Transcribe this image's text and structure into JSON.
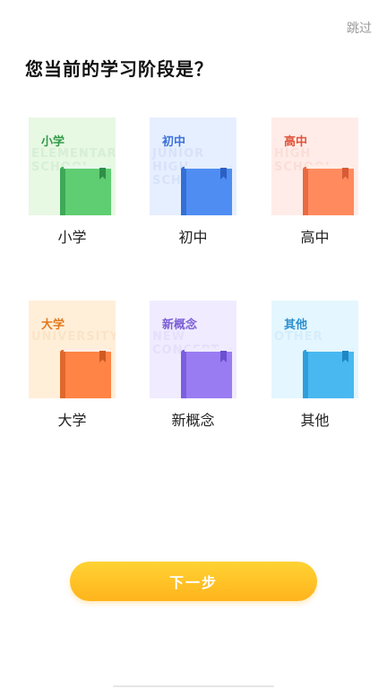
{
  "header": {
    "skip_label": "跳过"
  },
  "question": {
    "title": "您当前的学习阶段是？"
  },
  "options": [
    {
      "card_title": "小学",
      "watermark": "ELEMENTARY\nSCHOOL",
      "label": "小学",
      "colors": {
        "bg": "#e7f8e3",
        "title": "#2f9b46",
        "watermark": "#b9dfbf",
        "book": "#5fcd72",
        "spine": "#3ea957",
        "ribbon": "#2f8f49"
      }
    },
    {
      "card_title": "初中",
      "watermark": "JUNIOR\nHIGH\nSCHOOL",
      "label": "初中",
      "colors": {
        "bg": "#e6efff",
        "title": "#3d71d9",
        "watermark": "#bcccee",
        "book": "#4f8df2",
        "spine": "#356fd4",
        "ribbon": "#2b5fc2"
      }
    },
    {
      "card_title": "高中",
      "watermark": "HIGH\nSCHOOL",
      "label": "高中",
      "colors": {
        "bg": "#ffece8",
        "title": "#e0523a",
        "watermark": "#f3c7bd",
        "book": "#ff8a5e",
        "spine": "#e96a42",
        "ribbon": "#d85a36"
      }
    },
    {
      "card_title": "大学",
      "watermark": "UNIVERSITY",
      "label": "大学",
      "colors": {
        "bg": "#ffefd9",
        "title": "#e27a1f",
        "watermark": "#f2d1a8",
        "book": "#ff8446",
        "spine": "#e0682d",
        "ribbon": "#cf5a22"
      }
    },
    {
      "card_title": "新概念",
      "watermark": "NEW\nCONCEPT",
      "label": "新概念",
      "colors": {
        "bg": "#f0ebff",
        "title": "#7b5fd6",
        "watermark": "#d3c9f2",
        "book": "#9a7cf2",
        "spine": "#7c5fe0",
        "ribbon": "#6a4fd0"
      }
    },
    {
      "card_title": "其他",
      "watermark": "OTHER",
      "label": "其他",
      "colors": {
        "bg": "#e4f6ff",
        "title": "#2b8fcf",
        "watermark": "#b8def2",
        "book": "#4ab8f0",
        "spine": "#2f9fdc",
        "ribbon": "#1f86c4"
      }
    }
  ],
  "footer": {
    "next_label": "下一步",
    "button_color": "#ffc21f"
  }
}
